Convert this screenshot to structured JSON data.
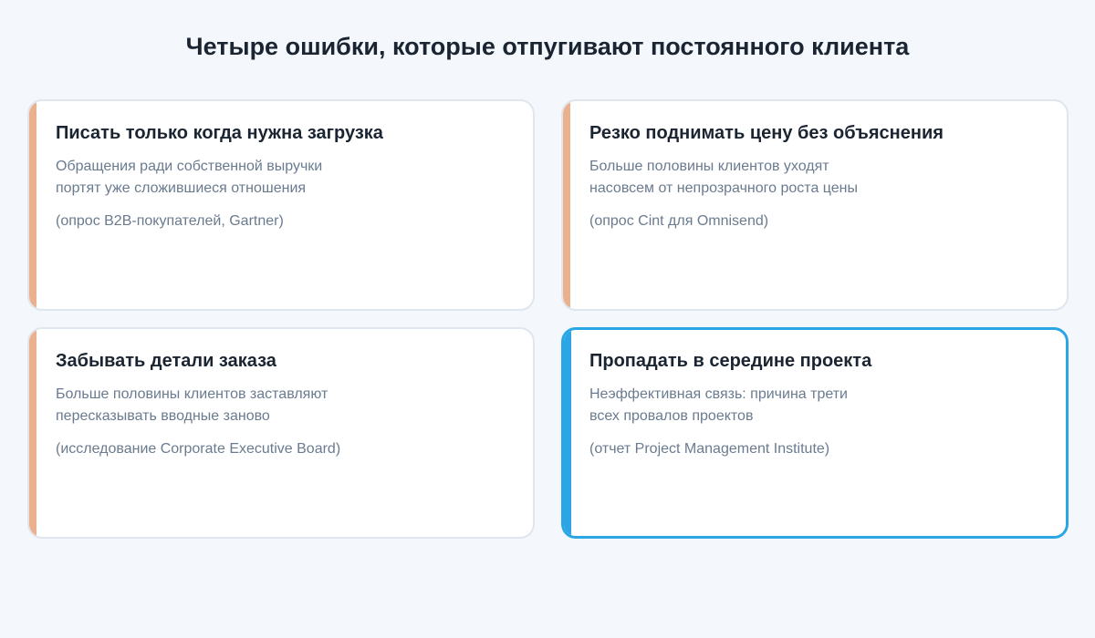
{
  "title": "Четыре ошибки, которые отпугивают постоянного клиента",
  "colors": {
    "accent": "#ebb08d",
    "highlight": "#2aa6e4",
    "background": "#f4f8fd"
  },
  "cards": [
    {
      "title": "Писать только когда нужна загрузка",
      "text_lines": [
        "Обращения ради собственной выручки",
        "портят уже сложившиеся отношения"
      ],
      "source": "(опрос B2B-покупателей, Gartner)"
    },
    {
      "title": "Резко поднимать цену без объяснения",
      "text_lines": [
        "Больше половины клиентов уходят",
        "насовсем от непрозрачного роста цены"
      ],
      "source": "(опрос Cint для Omnisend)"
    },
    {
      "title": "Забывать детали заказа",
      "text_lines": [
        "Больше половины клиентов заставляют",
        "пересказывать вводные заново"
      ],
      "source": "(исследование Corporate Executive Board)"
    },
    {
      "title": "Пропадать в середине проекта",
      "text_lines": [
        "Неэффективная связь: причина трети",
        "всех провалов проектов"
      ],
      "source": "(отчет Project Management Institute)"
    }
  ]
}
